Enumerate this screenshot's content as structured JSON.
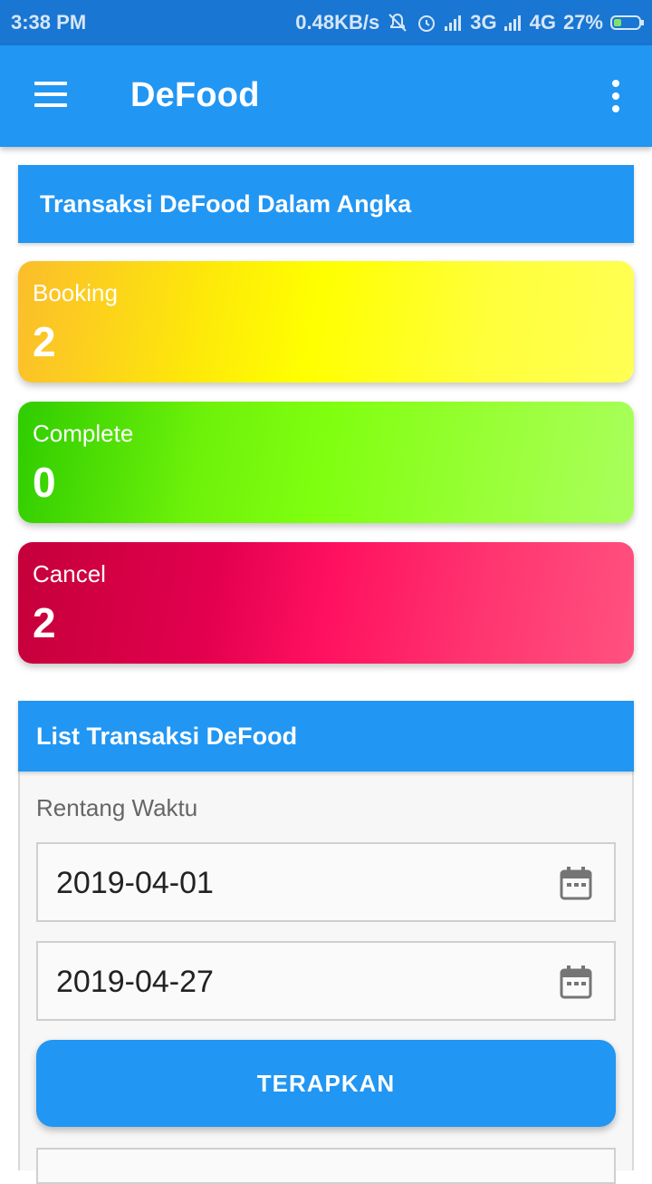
{
  "status_bar": {
    "time": "3:38 PM",
    "net_speed": "0.48KB/s",
    "network_3g": "3G",
    "network_4g": "4G",
    "battery": "27%"
  },
  "app_bar": {
    "title": "DeFood",
    "menu_icon": "hamburger-menu-icon",
    "overflow_icon": "more-vert-icon"
  },
  "summary": {
    "header": "Transaksi DeFood Dalam Angka",
    "cards": [
      {
        "label": "Booking",
        "value": "2"
      },
      {
        "label": "Complete",
        "value": "0"
      },
      {
        "label": "Cancel",
        "value": "2"
      }
    ]
  },
  "transactions": {
    "header": "List Transaksi DeFood",
    "range_label": "Rentang Waktu",
    "start_date": "2019-04-01",
    "end_date": "2019-04-27",
    "apply_label": "TERAPKAN"
  },
  "colors": {
    "primary": "#2196F3",
    "status_bar": "#1976D2",
    "booking": "#FFFF00",
    "complete": "#80FF10",
    "cancel": "#FF1060"
  }
}
